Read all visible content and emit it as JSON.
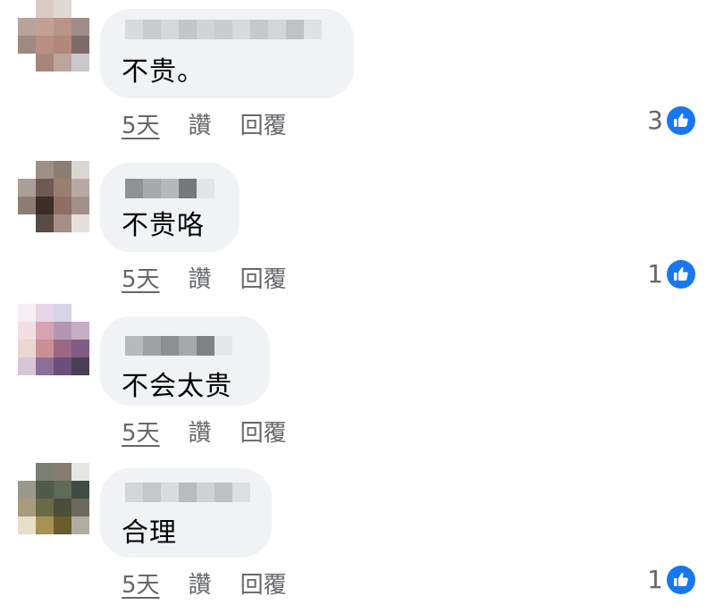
{
  "theme": {
    "bubble_bg": "#f0f2f5",
    "action_text": "#65676b",
    "like_blue": "#1877f2"
  },
  "comments": [
    {
      "text": "不贵。",
      "time": "5天",
      "like_label": "讚",
      "reply_label": "回覆",
      "reaction_count": "3",
      "reaction_icon": "like-thumb-icon"
    },
    {
      "text": "不贵咯",
      "time": "5天",
      "like_label": "讚",
      "reply_label": "回覆",
      "reaction_count": "1",
      "reaction_icon": "like-thumb-icon"
    },
    {
      "text": "不会太贵",
      "time": "5天",
      "like_label": "讚",
      "reply_label": "回覆",
      "reaction_count": "",
      "reaction_icon": ""
    },
    {
      "text": "合理",
      "time": "5天",
      "like_label": "讚",
      "reply_label": "回覆",
      "reaction_count": "1",
      "reaction_icon": "like-thumb-icon"
    }
  ]
}
